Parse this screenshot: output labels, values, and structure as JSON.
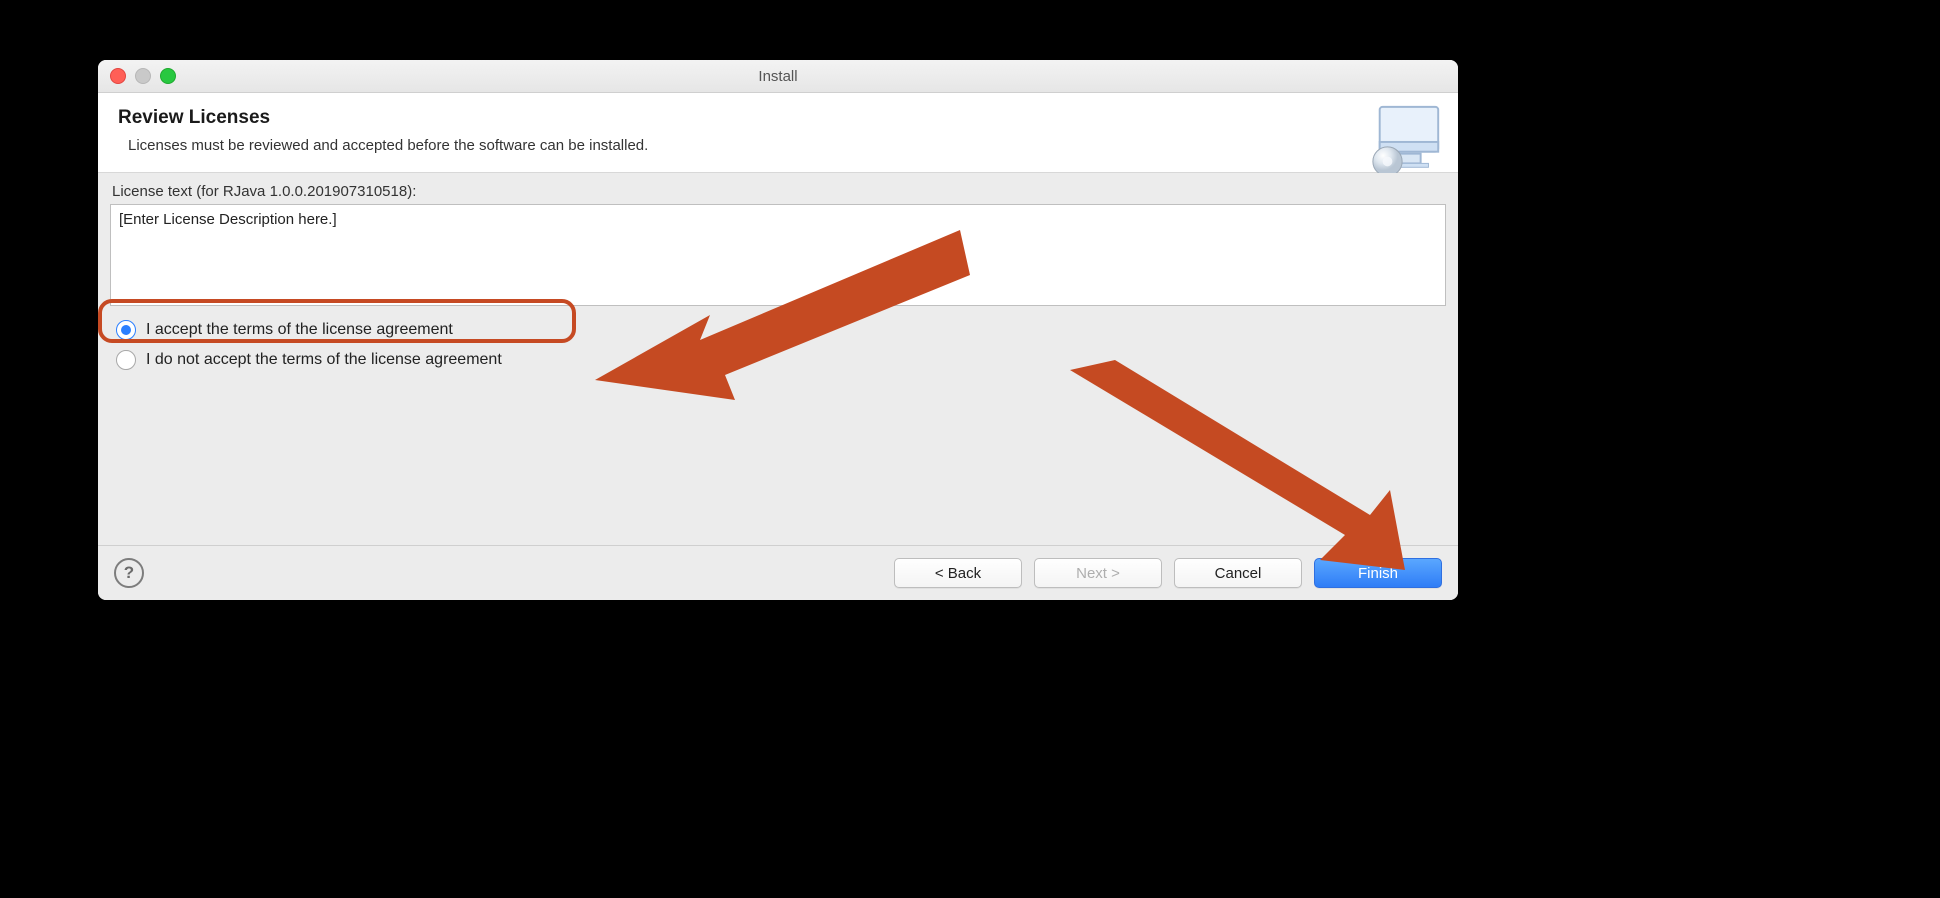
{
  "window": {
    "title": "Install"
  },
  "header": {
    "title": "Review Licenses",
    "subtitle": "Licenses must be reviewed and accepted before the software can be installed."
  },
  "license": {
    "label": "License text (for RJava 1.0.0.201907310518):",
    "text": "[Enter License Description here.]"
  },
  "radios": {
    "accept": "I accept the terms of the license agreement",
    "reject": "I do not accept the terms of the license agreement",
    "selected": "accept"
  },
  "footer": {
    "back": "< Back",
    "next": "Next >",
    "cancel": "Cancel",
    "finish": "Finish"
  },
  "annotations": {
    "highlight_target": "accept-radio",
    "arrows_point_to": [
      "accept-radio-row",
      "finish-button"
    ],
    "arrow_color": "#c54a22"
  }
}
